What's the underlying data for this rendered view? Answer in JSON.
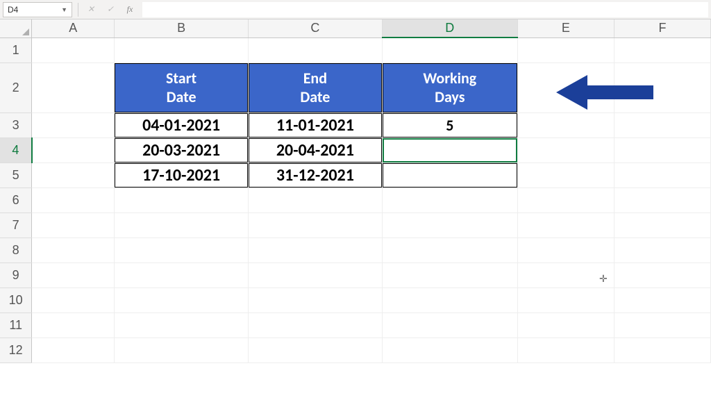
{
  "formula_bar": {
    "name_box": "D4",
    "cancel_icon": "✕",
    "confirm_icon": "✓",
    "fx_label": "fx",
    "formula_value": ""
  },
  "columns": [
    "A",
    "B",
    "C",
    "D",
    "E",
    "F"
  ],
  "rows": [
    "1",
    "2",
    "3",
    "4",
    "5",
    "6",
    "7",
    "8",
    "9",
    "10",
    "11",
    "12"
  ],
  "selected": {
    "col": "D",
    "row": "4"
  },
  "headers": {
    "b": "Start\nDate",
    "c": "End\nDate",
    "d": "Working\nDays"
  },
  "data_rows": [
    {
      "b": "04-01-2021",
      "c": "11-01-2021",
      "d": "5"
    },
    {
      "b": "20-03-2021",
      "c": "20-04-2021",
      "d": ""
    },
    {
      "b": "17-10-2021",
      "c": "31-12-2021",
      "d": ""
    }
  ],
  "arrow_color": "#1b3f99"
}
